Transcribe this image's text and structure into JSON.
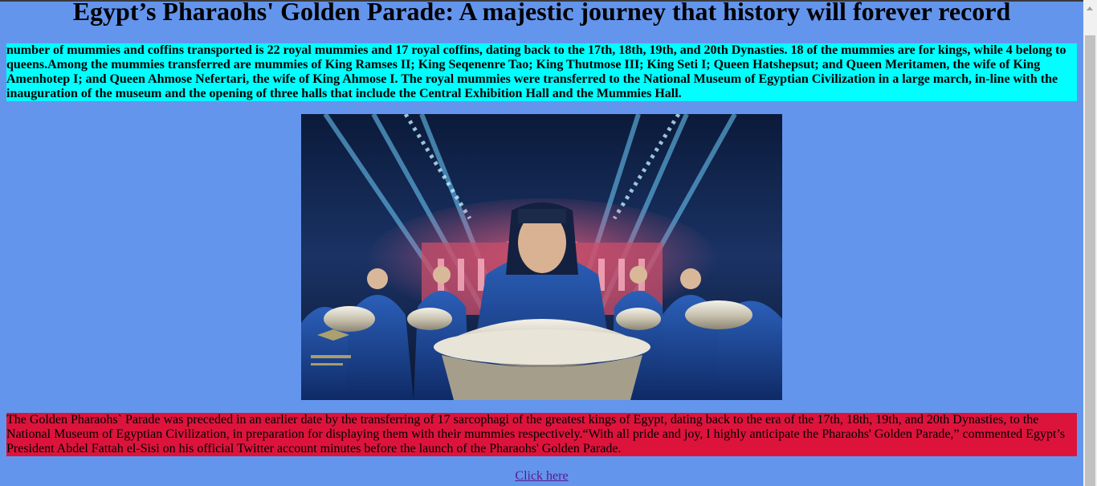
{
  "page": {
    "title": "Egypt’s Pharaohs' Golden Parade: A majestic journey that history will forever record",
    "intro": "number of mummies and coffins transported is 22 royal mummies and 17 royal coffins, dating back to the 17th, 18th, 19th, and 20th Dynasties. 18 of the mummies are for kings, while 4 belong to queens.Among the mummies transferred are mummies of King Ramses II; King Seqenenre Tao; King Thutmose III; King Seti I; Queen Hatshepsut; and Queen Meritamen, the wife of King Amenhotep I; and Queen Ahmose Nefertari, the wife of King Ahmose I. The royal mummies were transferred to the National Museum of Egyptian Civilization in a large march, in-line with the inauguration of the museum and the opening of three halls that include the Central Exhibition Hall and the Mummies Hall.",
    "outro": "The Golden Pharaohs` Parade was preceded in an earlier date by the transferring of 17 sarcophagi of the greatest kings of Egypt, dating back to the era of the 17th, 18th, 19th, and 20th Dynasties, to the National Museum of Egyptian Civilization, in preparation for displaying them with their mummies respectively.“With all pride and joy, I highly anticipate the Pharaohs' Golden Parade,” commented Egypt’s President Abdel Fattah el-Sisi on his official Twitter account minutes before the launch of the Pharaohs' Golden Parade.",
    "link_label": "Click here"
  },
  "colors": {
    "background": "#6495ED",
    "intro_bg": "#00FFFF",
    "outro_bg": "#DC143C",
    "link": "#551A8B"
  }
}
